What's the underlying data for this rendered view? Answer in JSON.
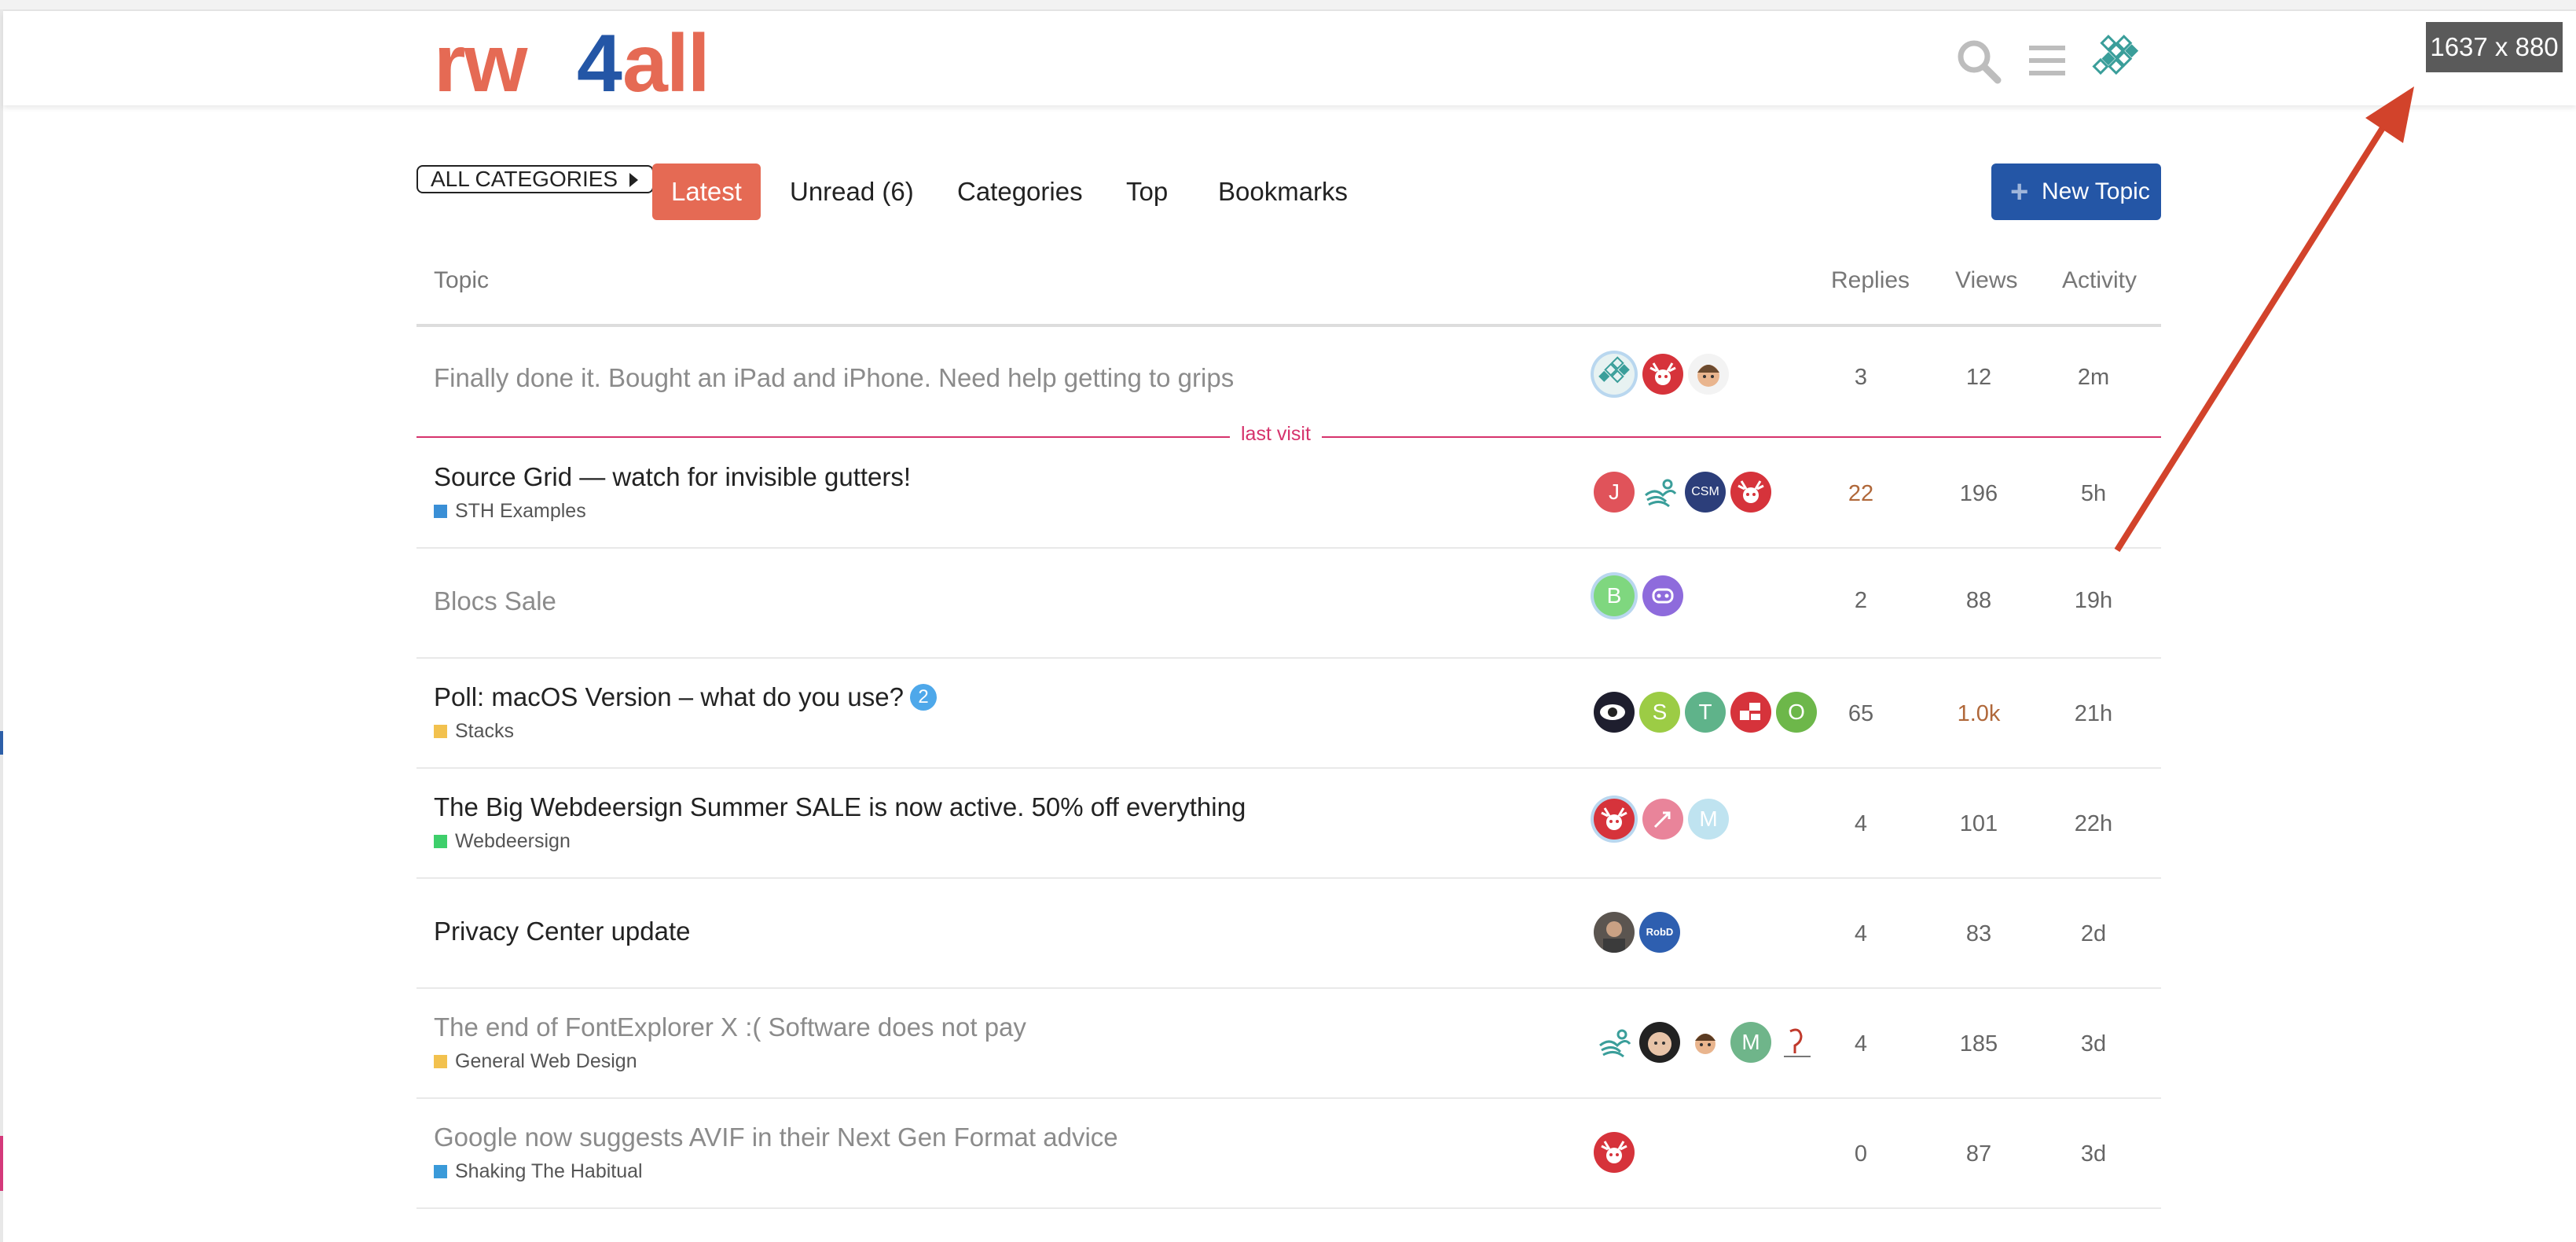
{
  "header": {
    "logo_text": "rw4all",
    "size_label": "1637 x 880"
  },
  "nav": {
    "all_categories": "ALL CATEGORIES",
    "tabs": [
      {
        "label": "Latest"
      },
      {
        "label": "Unread (6)"
      },
      {
        "label": "Categories"
      },
      {
        "label": "Top"
      },
      {
        "label": "Bookmarks"
      }
    ],
    "new_topic": "New Topic"
  },
  "table": {
    "headers": {
      "topic": "Topic",
      "replies": "Replies",
      "views": "Views",
      "activity": "Activity"
    },
    "last_visit": "last visit",
    "rows": [
      {
        "title": "Finally done it. Bought an iPad and iPhone. Need help getting to grips",
        "category": "",
        "replies": "3",
        "views": "12",
        "activity": "2m"
      },
      {
        "title": "Source Grid — watch for invisible gutters!",
        "category": "STH Examples",
        "replies": "22",
        "views": "196",
        "activity": "5h"
      },
      {
        "title": "Blocs Sale",
        "category": "",
        "replies": "2",
        "views": "88",
        "activity": "19h"
      },
      {
        "title": "Poll: macOS Version – what do you use?",
        "badge": "2",
        "category": "Stacks",
        "replies": "65",
        "views": "1.0k",
        "activity": "21h"
      },
      {
        "title": "The Big Webdeersign Summer SALE is now active. 50% off everything",
        "category": "Webdeersign",
        "replies": "4",
        "views": "101",
        "activity": "22h"
      },
      {
        "title": "Privacy Center update",
        "category": "",
        "replies": "4",
        "views": "83",
        "activity": "2d"
      },
      {
        "title": "The end of FontExplorer X :( Software does not pay",
        "category": "General Web Design",
        "replies": "4",
        "views": "185",
        "activity": "3d"
      },
      {
        "title": "Google now suggests AVIF in their Next Gen Format advice",
        "category": "Shaking The Habitual",
        "replies": "0",
        "views": "87",
        "activity": "3d"
      }
    ],
    "avatar_letters": {
      "r1_a1": "J",
      "r2_a1": "B",
      "r3_a2": "S",
      "r3_a3": "T",
      "r3_a5": "O",
      "r4_a3": "M",
      "r6_a4": "M",
      "r1_a3": "CSM",
      "r5_a2": "RobD"
    }
  },
  "colors": {
    "accent": "#e56a54",
    "primary": "#2456a6",
    "last_visit": "#d6336c",
    "cat_sth": "#3a8fd6",
    "cat_stacks": "#f2c14e",
    "cat_webdeersign": "#3ecf6b",
    "cat_general": "#f2c14e",
    "cat_shaking": "#3a9ad9"
  }
}
